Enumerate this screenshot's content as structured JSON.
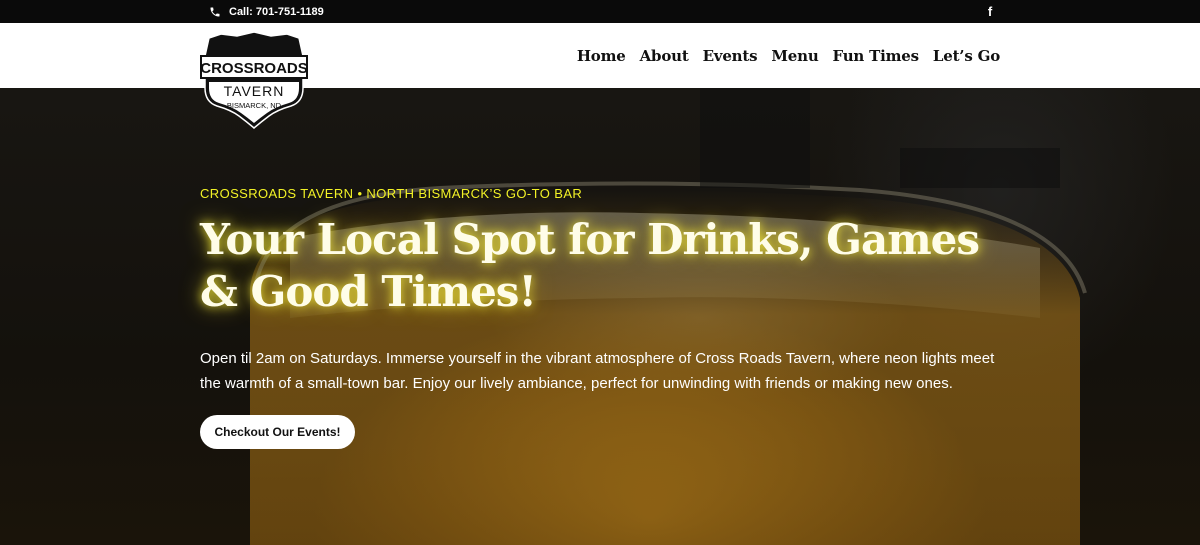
{
  "topbar": {
    "phone_label": "Call: 701-751-1189",
    "phone_icon": "phone-icon",
    "social_icon": "facebook-icon"
  },
  "logo": {
    "line1": "CROSSROADS",
    "line2": "TAVERN",
    "line3": "- BISMARCK, ND -"
  },
  "nav": {
    "items": [
      "Home",
      "About",
      "Events",
      "Menu",
      "Fun Times",
      "Let’s Go"
    ]
  },
  "hero": {
    "eyebrow": "CROSSROADS TAVERN • NORTH BISMARCK’S GO-TO BAR",
    "headline": "Your Local Spot for Drinks, Games & Good Times!",
    "intro": "Open til 2am on Saturdays. Immerse yourself in the vibrant atmosphere of Cross Roads Tavern, where neon lights meet the warmth of a small-town bar. Enjoy our lively ambiance, perfect for unwinding with friends or making new ones.",
    "cta_label": "Checkout Our Events!"
  },
  "colors": {
    "accent_yellow": "#f2f226",
    "headline_glow": "#fff53c",
    "topbar_bg": "#0a0a0a",
    "header_bg": "#ffffff"
  }
}
